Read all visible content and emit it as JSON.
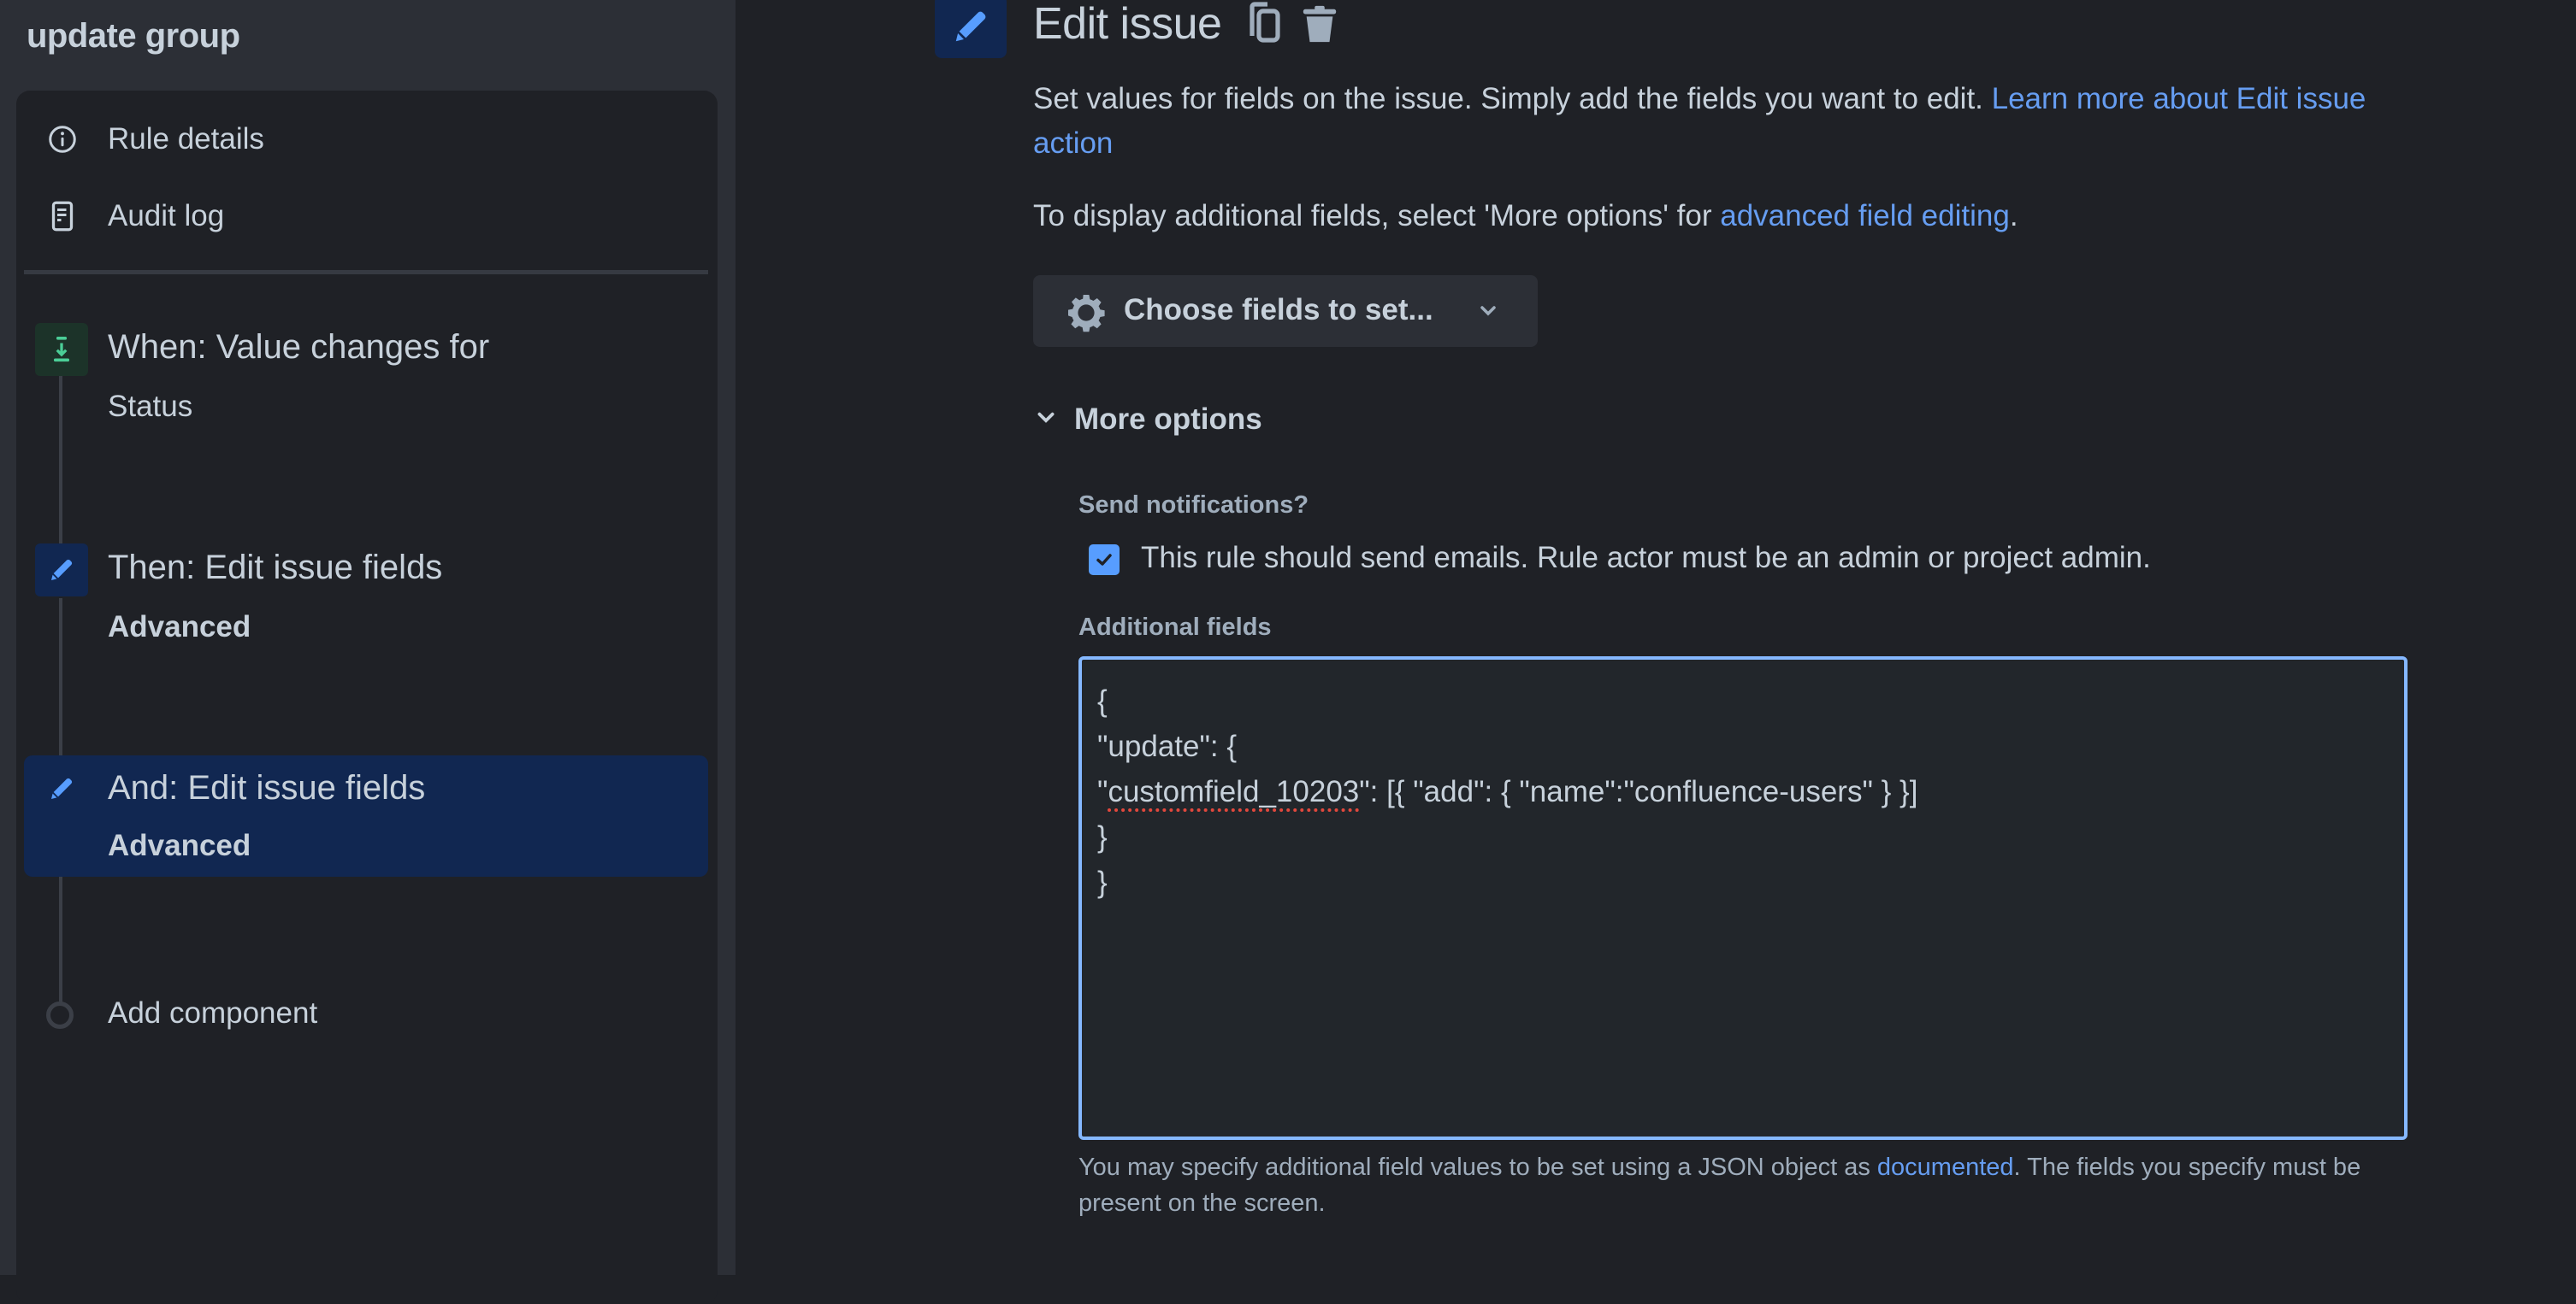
{
  "sidebar": {
    "title": "update group",
    "nav": [
      {
        "label": "Rule details",
        "icon": "info-icon"
      },
      {
        "label": "Audit log",
        "icon": "document-icon"
      }
    ],
    "steps": [
      {
        "title": "When: Value changes for",
        "subtitle": "Status",
        "icon": "trigger-icon",
        "color": "#4bce97",
        "bg": "#1c3329",
        "selected": false
      },
      {
        "title": "Then: Edit issue fields",
        "subtitle": "Advanced",
        "icon": "pencil-icon",
        "color": "#579dff",
        "bg": "#112751",
        "selected": false
      },
      {
        "title": "And: Edit issue fields",
        "subtitle": "Advanced",
        "icon": "pencil-icon",
        "color": "#579dff",
        "bg": "#112751",
        "selected": true
      }
    ],
    "add_component": "Add component"
  },
  "main": {
    "title": "Edit issue",
    "description_text": "Set values for fields on the issue. Simply add the fields you want to edit. ",
    "description_link": "Learn more about Edit issue action",
    "display_text": "To display additional fields, select 'More options' for ",
    "display_link": "advanced field editing",
    "display_end": ".",
    "choose_fields_button": "Choose fields to set...",
    "more_options": "More options",
    "send_notifications": {
      "label": "Send notifications?",
      "checkbox_label": "This rule should send emails. Rule actor must be an admin or project admin.",
      "checked": true
    },
    "additional_fields": {
      "label": "Additional fields",
      "lines": [
        "{",
        "\"update\": {",
        "\"customfield_10203\": [{ \"add\": { \"name\":\"confluence-users\" } }]",
        "}",
        "}"
      ],
      "misspelled_token": "customfield_10203"
    },
    "helper_text_start": "You may specify additional field values to be set using a JSON object as ",
    "helper_link": "documented",
    "helper_text_end": ". The fields you specify must be present on the screen."
  },
  "colors": {
    "accent": "#579dff",
    "link": "#669df1",
    "focus_border": "#85b8ff",
    "selected_bg": "#112751",
    "sidebar_bg": "#2c2f36",
    "main_bg": "#1f2126"
  }
}
